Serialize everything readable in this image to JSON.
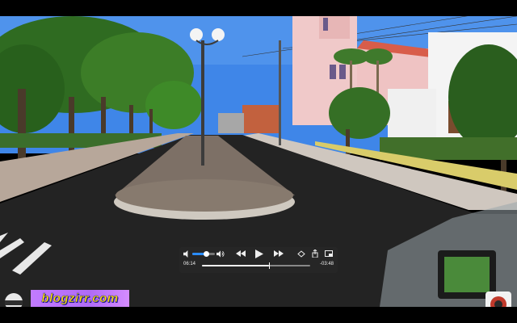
{
  "player": {
    "time_elapsed": "06:14",
    "time_remaining": "-03:48",
    "progress": 0.621,
    "volume": 0.6,
    "state": "paused"
  },
  "controls": {
    "volume_icon": "speaker-low-icon",
    "volume_max_icon": "speaker-high-icon",
    "rewind_icon": "rewind-icon",
    "play_icon": "play-icon",
    "ffwd_icon": "fast-forward-icon",
    "pip_icon": "picture-in-picture-icon",
    "share_icon": "share-icon",
    "mini_icon": "mini-player-icon"
  },
  "watermark": {
    "text": "blogzirr.com",
    "colors": {
      "bg": "#b06cf5",
      "text": "#ffe100"
    }
  },
  "scene": {
    "sky": "#3f86e8",
    "road": "#232323",
    "church": "#f0c9c9"
  }
}
